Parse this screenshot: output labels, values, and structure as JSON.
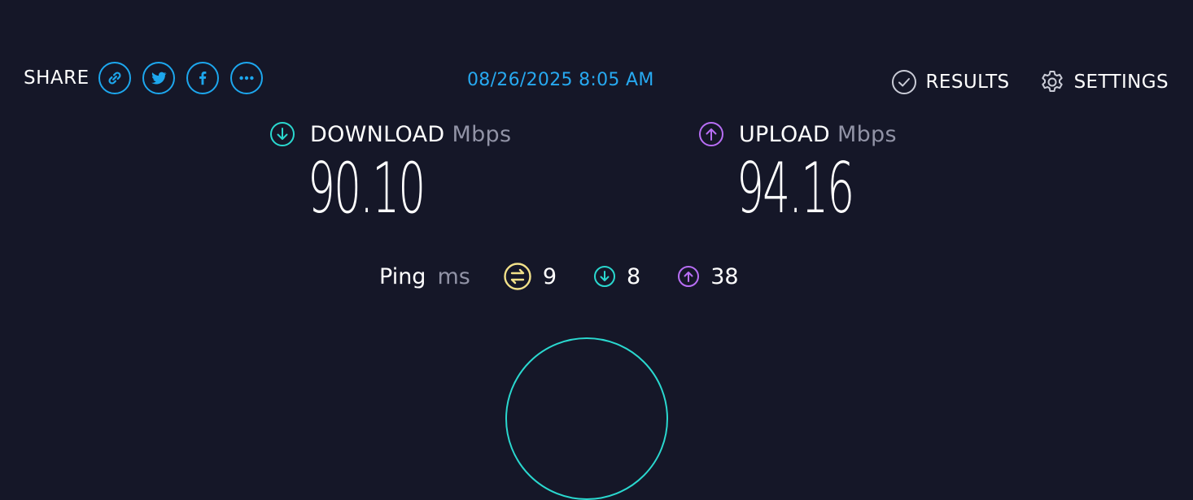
{
  "share": {
    "label": "SHARE",
    "buttons": [
      "link-icon",
      "twitter-icon",
      "facebook-icon",
      "more-icon"
    ]
  },
  "timestamp": "08/26/2025 8:05 AM",
  "nav": {
    "results": "RESULTS",
    "settings": "SETTINGS"
  },
  "download": {
    "label": "DOWNLOAD",
    "unit": "Mbps",
    "value": "90.10"
  },
  "upload": {
    "label": "UPLOAD",
    "unit": "Mbps",
    "value": "94.16"
  },
  "ping": {
    "label": "Ping",
    "unit": "ms",
    "idle": "9",
    "download": "8",
    "upload": "38"
  },
  "colors": {
    "background": "#151728",
    "accent_blue": "#1da7ee",
    "download": "#2ad8cf",
    "upload": "#b86ef5",
    "ping": "#f3e28a",
    "muted": "#9193a6"
  }
}
